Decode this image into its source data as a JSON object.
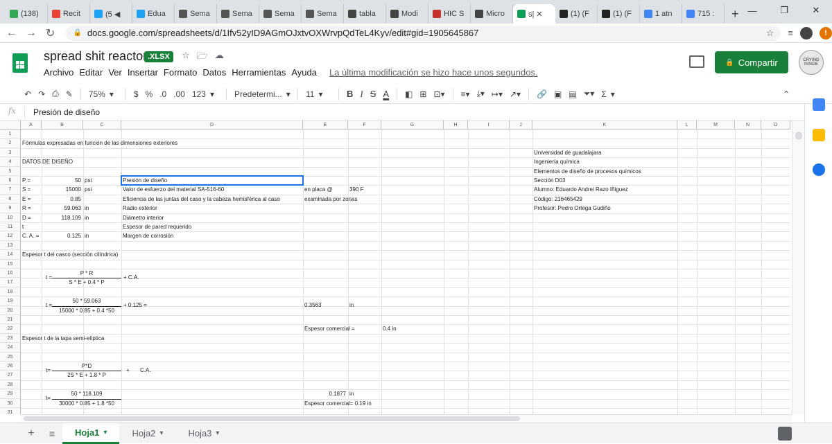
{
  "browser": {
    "tabs": [
      {
        "label": "(138)",
        "color": "#34a853"
      },
      {
        "label": "Recit",
        "color": "#ea4335"
      },
      {
        "label": "(5 ◀",
        "color": "#1da1f2"
      },
      {
        "label": "Edua",
        "color": "#1da1f2"
      },
      {
        "label": "Sema",
        "color": "#555555"
      },
      {
        "label": "Sema",
        "color": "#555555"
      },
      {
        "label": "Sema",
        "color": "#555555"
      },
      {
        "label": "Sema",
        "color": "#555555"
      },
      {
        "label": "tabla",
        "color": "#444444"
      },
      {
        "label": "Modi",
        "color": "#444444"
      },
      {
        "label": "HIC S",
        "color": "#c4302b"
      },
      {
        "label": "Micro",
        "color": "#444444"
      },
      {
        "label": "s| ✕",
        "color": "#0f9d58"
      },
      {
        "label": "(1) (F",
        "color": "#222222"
      },
      {
        "label": "(1) (F",
        "color": "#222222"
      },
      {
        "label": "1 atn",
        "color": "#4285f4"
      },
      {
        "label": "715 :",
        "color": "#4285f4"
      }
    ],
    "new_tab": "+",
    "url": "docs.google.com/spreadsheets/d/1Ifv52yID9AGmOJxtvOXWrvpQdTeL4Kyv/edit#gid=1905645867"
  },
  "document": {
    "title": "spread shit reactor",
    "format_badge": ".XLSX",
    "menu": [
      "Archivo",
      "Editar",
      "Ver",
      "Insertar",
      "Formato",
      "Datos",
      "Herramientas",
      "Ayuda"
    ],
    "last_edit": "La última modificación se hizo hace unos segundos.",
    "share_label": "Compartir",
    "avatar_text": "CRYING INSIDE"
  },
  "toolbar": {
    "zoom": "75%",
    "currency": "$",
    "percent": "%",
    "dec_less": ".0",
    "dec_more": ".00",
    "number_format": "123",
    "font": "Predetermi...",
    "font_size": "11",
    "bold": "B",
    "italic": "I",
    "strike": "S",
    "text_color": "A",
    "sum": "Σ"
  },
  "formula_bar": {
    "fx": "fx",
    "value": "Presión de diseño"
  },
  "columns": [
    "A",
    "B",
    "C",
    "D",
    "E",
    "F",
    "G",
    "H",
    "I",
    "J",
    "K",
    "L",
    "M",
    "N",
    "O"
  ],
  "rows": [
    "1",
    "2",
    "3",
    "4",
    "5",
    "6",
    "7",
    "8",
    "9",
    "10",
    "11",
    "12",
    "13",
    "14",
    "15",
    "16",
    "17",
    "18",
    "19",
    "20",
    "21",
    "22",
    "23",
    "24",
    "25",
    "26",
    "27",
    "28",
    "29",
    "30",
    "31"
  ],
  "cells": {
    "a2": "Fórmulas expresadas en función de las dimensiones exteriores",
    "a4": "DATOS DE DISEÑO",
    "a6": "P =",
    "b6": "50",
    "c6": "psi",
    "d6": "Presión de diseño",
    "a7": "S =",
    "b7": "15000",
    "c7": "psi",
    "d7": "Valor de esfuerzo del material SA-516-60",
    "e7": "en placa @",
    "f7": "390 F",
    "a8": "E =",
    "b8": "0.85",
    "d8": "Eficiencia de las juntas del caso y la cabeza hemisférica al caso",
    "e8": "examinada por zonas",
    "a9": "R =",
    "b9": "59.063",
    "c9": "in",
    "d9": "Radio exterior",
    "a10": "D =",
    "b10": "118.109",
    "c10": "in",
    "d10": "Diámetro interior",
    "a11": "t",
    "d11": "Espesor de pared requerido",
    "a12": "C. A. =",
    "b12": "0.125",
    "c12": "in",
    "d12": "Margen de corrosión",
    "a14": "Espesor t del casco (sección cilíndrica)",
    "f16_num": "P * R",
    "f17_den": "S * E + 0.4 * P",
    "f16_t": "t =",
    "f16_plus": "+ C.A.",
    "f19_num": "50 * 59.063",
    "f20_den": "15000 * 0.85 + 0.4 *50",
    "f19_t": "t =",
    "f19_plus": "+ 0.125 =",
    "e19": "0.3563",
    "f19": "in",
    "e22": "Espesor comercial =",
    "g22": "0.4 in",
    "a23": "Espesor t de la tapa semi-elíptica",
    "f26_num": "P*D",
    "f27_den": "2S * E + 1.8 * P",
    "f26_t": "t=",
    "f26_plus": "+",
    "f26_ca": "C.A.",
    "f29_num": "50 * 118.109",
    "f30_den": "30000 * 0.85 + 1.8 *50",
    "f29_t": "t=",
    "e29": "0.1877",
    "f29": "in",
    "e30": "Espesor comercial= 0.19 in",
    "k3": "Universidad de guadalajara",
    "k4": "Ingeniería química",
    "k5": "Elementos de diseño de procesos químicos",
    "k6": "Sección D03",
    "k7": "Alumno: Eduardo Andrei Razo Iñiguez",
    "k8": "Código: 216465429",
    "k9": "Profesor: Pedro Ortega Gudiño"
  },
  "sheets": [
    {
      "label": "Hoja1",
      "active": true
    },
    {
      "label": "Hoja2",
      "active": false
    },
    {
      "label": "Hoja3",
      "active": false
    }
  ],
  "colors": {
    "accent_green": "#188038",
    "selection_blue": "#1a73e8"
  }
}
